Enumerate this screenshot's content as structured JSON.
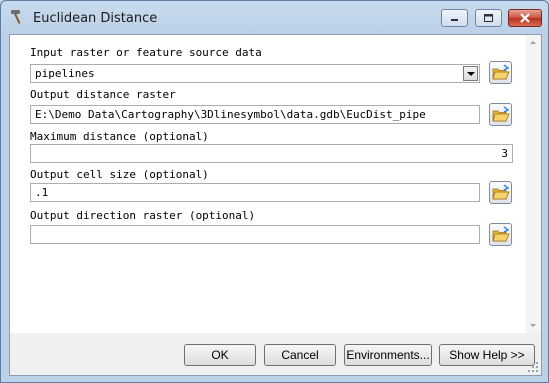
{
  "window": {
    "title": "Euclidean Distance"
  },
  "fields": {
    "input_raster": {
      "label": "Input raster or feature source data",
      "value": "pipelines"
    },
    "output_distance": {
      "label": "Output distance raster",
      "value": "E:\\Demo Data\\Cartography\\3Dlinesymbol\\data.gdb\\EucDist_pipe"
    },
    "max_distance": {
      "label": "Maximum distance (optional)",
      "value": "3"
    },
    "cell_size": {
      "label": "Output cell size (optional)",
      "value": ".1"
    },
    "direction_raster": {
      "label": "Output direction raster (optional)",
      "value": ""
    }
  },
  "buttons": {
    "ok": "OK",
    "cancel": "Cancel",
    "environments": "Environments...",
    "show_help": "Show Help >>"
  },
  "icons": {
    "app": "hammer-icon",
    "browse": "open-folder-icon"
  }
}
